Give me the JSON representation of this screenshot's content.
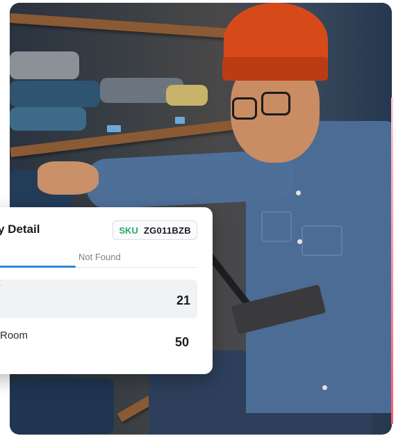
{
  "photo": {
    "description_icon": "person-photo"
  },
  "card": {
    "title": "ory Detail",
    "sku": {
      "label": "SKU",
      "value": "ZG011BZB"
    },
    "tabs": [
      {
        "label": "",
        "active": true
      },
      {
        "label": "Not Found",
        "active": false
      }
    ],
    "rows": [
      {
        "label": "/",
        "value": "21",
        "highlighted": true
      },
      {
        "label": "Room",
        "value": "50",
        "highlighted": false
      }
    ]
  },
  "colors": {
    "accent": "#2d8ad9",
    "sku_green": "#2fa766",
    "beanie": "#d64a1a"
  }
}
